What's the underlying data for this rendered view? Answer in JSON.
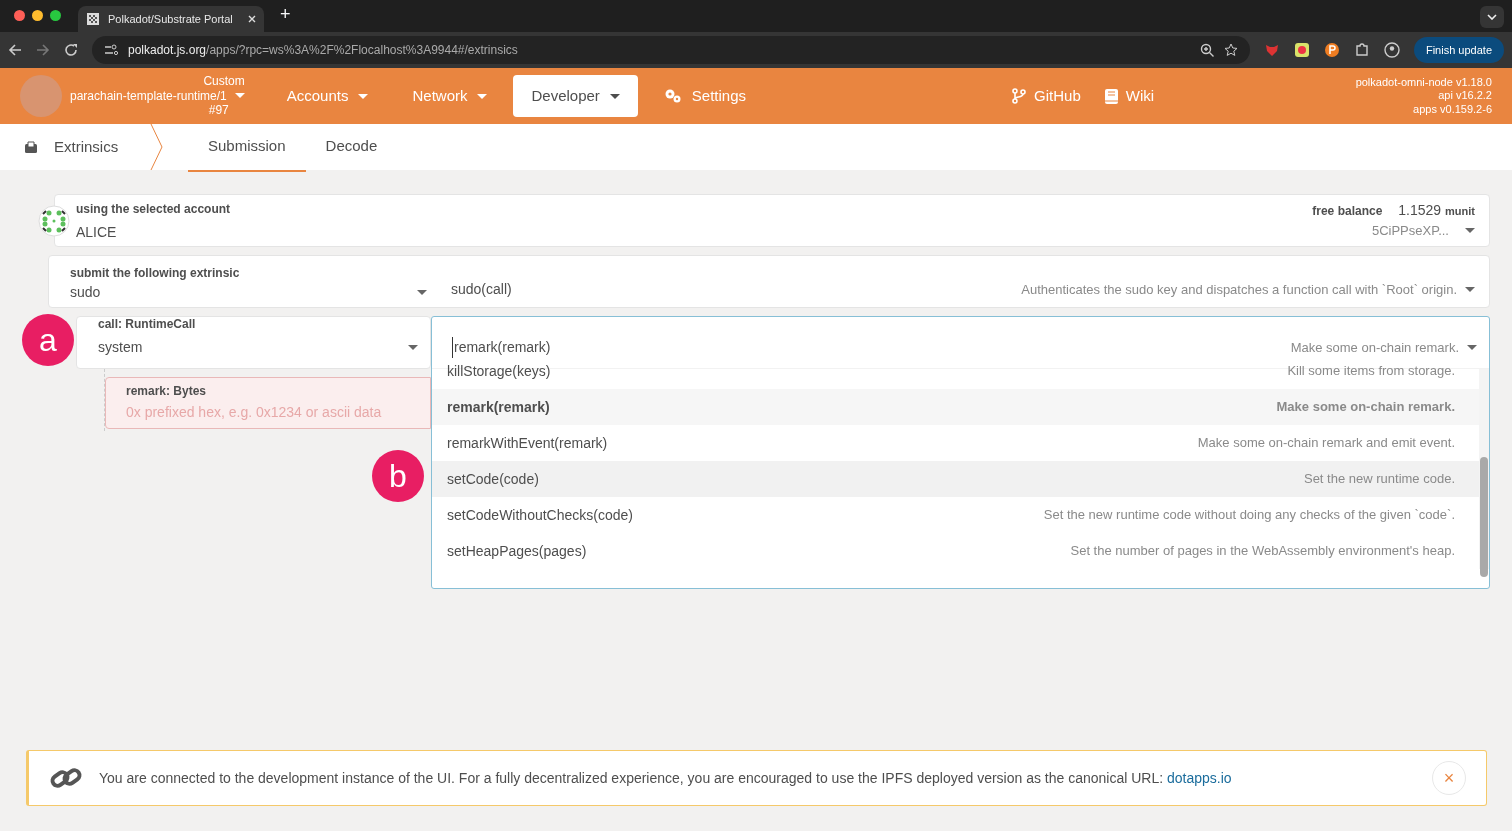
{
  "browser": {
    "tab_title": "Polkadot/Substrate Portal",
    "new_tab": "+",
    "url_host": "polkadot.js.org",
    "url_path": "/apps/?rpc=ws%3A%2F%2Flocalhost%3A9944#/extrinsics",
    "update_button": "Finish update"
  },
  "header": {
    "chain_label": "Custom",
    "chain_name": "parachain-template-runtime/1",
    "block": "#97",
    "menu": [
      {
        "label": "Accounts",
        "kind": "dropdown",
        "selected": false
      },
      {
        "label": "Network",
        "kind": "dropdown",
        "selected": false
      },
      {
        "label": "Developer",
        "kind": "dropdown",
        "selected": true
      },
      {
        "label": "Settings",
        "kind": "settings",
        "selected": false
      }
    ],
    "links": [
      {
        "label": "GitHub",
        "kind": "github"
      },
      {
        "label": "Wiki",
        "kind": "wiki"
      }
    ],
    "versions": [
      "polkadot-omni-node v1.18.0",
      "api v16.2.2",
      "apps v0.159.2-6"
    ]
  },
  "subnav": {
    "section": "Extrinsics",
    "tabs": [
      {
        "label": "Submission",
        "selected": true
      },
      {
        "label": "Decode",
        "selected": false
      }
    ]
  },
  "account": {
    "label": "using the selected account",
    "name": "ALICE",
    "balance_label": "free balance",
    "balance": "1.1529",
    "unit": "munit",
    "address": "5CiPPseXP..."
  },
  "extrinsic": {
    "label": "submit the following extrinsic",
    "pallet": "sudo",
    "call": "sudo(call)",
    "description": "Authenticates the sudo key and dispatches a function call with `Root` origin."
  },
  "call": {
    "label": "call: RuntimeCall",
    "pallet": "system",
    "search": "remark(remark)",
    "description": "Make some on-chain remark.",
    "options": [
      {
        "name": "killStorage(keys)",
        "description": "Kill some items from storage.",
        "selected": false,
        "highlighted": false
      },
      {
        "name": "remark(remark)",
        "description": "Make some on-chain remark.",
        "selected": true,
        "highlighted": false
      },
      {
        "name": "remarkWithEvent(remark)",
        "description": "Make some on-chain remark and emit event.",
        "selected": false,
        "highlighted": false
      },
      {
        "name": "setCode(code)",
        "description": "Set the new runtime code.",
        "selected": false,
        "highlighted": true
      },
      {
        "name": "setCodeWithoutChecks(code)",
        "description": "Set the new runtime code without doing any checks of the given `code`.",
        "selected": false,
        "highlighted": false
      },
      {
        "name": "setHeapPages(pages)",
        "description": "Set the number of pages in the WebAssembly environment's heap.",
        "selected": false,
        "highlighted": false
      }
    ]
  },
  "param": {
    "label": "remark: Bytes",
    "placeholder": "0x prefixed hex, e.g. 0x1234 or ascii data"
  },
  "annotations": [
    "a",
    "b"
  ],
  "notice": {
    "text": "You are connected to the development instance of the UI. For a fully decentralized experience, you are encouraged to use the IPFS deployed version as the canonical URL:",
    "link": "dotapps.io",
    "close": "×"
  }
}
